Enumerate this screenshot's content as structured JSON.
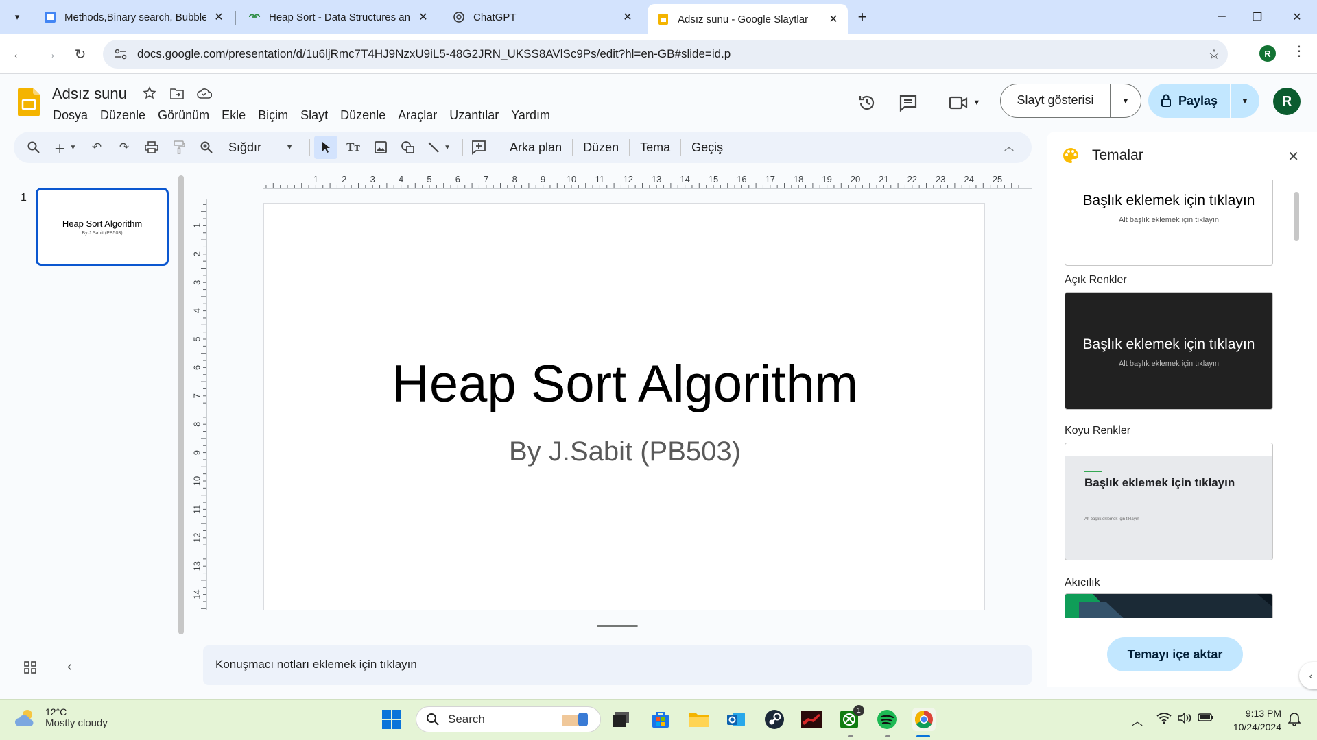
{
  "browser": {
    "tabs": [
      {
        "title": "Methods,Binary search, Bubble",
        "favicon": "slides-favicon",
        "active": false
      },
      {
        "title": "Heap Sort - Data Structures and",
        "favicon": "gfg-favicon",
        "active": false
      },
      {
        "title": "ChatGPT",
        "favicon": "chatgpt-favicon",
        "active": false
      },
      {
        "title": "Adsız sunu - Google Slaytlar",
        "favicon": "slides-favicon",
        "active": true
      }
    ],
    "url": "docs.google.com/presentation/d/1u6ljRmc7T4HJ9NzxU9iL5-48G2JRN_UKSS8AVlSc9Ps/edit?hl=en-GB#slide=id.p",
    "profile_initial": "R"
  },
  "app": {
    "doc_title": "Adsız sunu",
    "menu": [
      "Dosya",
      "Düzenle",
      "Görünüm",
      "Ekle",
      "Biçim",
      "Slayt",
      "Düzenle",
      "Araçlar",
      "Uzantılar",
      "Yardım"
    ],
    "slideshow_label": "Slayt gösterisi",
    "share_label": "Paylaş",
    "avatar_initial": "R"
  },
  "toolbar": {
    "zoom_label": "Sığdır",
    "text_buttons": [
      "Arka plan",
      "Düzen",
      "Tema",
      "Geçiş"
    ]
  },
  "rulers": {
    "horizontal": [
      "1",
      "2",
      "3",
      "4",
      "5",
      "6",
      "7",
      "8",
      "9",
      "10",
      "11",
      "12",
      "13",
      "14",
      "15",
      "16",
      "17",
      "18",
      "19",
      "20",
      "21",
      "22",
      "23",
      "24",
      "25"
    ],
    "vertical": [
      "1",
      "2",
      "3",
      "4",
      "5",
      "6",
      "7",
      "8",
      "9",
      "10",
      "11",
      "12",
      "13",
      "14"
    ]
  },
  "filmstrip": {
    "slide_number": "1",
    "thumb_title": "Heap Sort Algorithm",
    "thumb_subtitle": "By J.Sabit (PB503)"
  },
  "slide": {
    "title": "Heap Sort Algorithm",
    "subtitle": "By J.Sabit (PB503)"
  },
  "notes_placeholder": "Konuşmacı notları eklemek için tıklayın",
  "themes": {
    "title": "Temalar",
    "preview_title": "Başlık eklemek için tıklayın",
    "preview_subtitle": "Alt başlık eklemek için tıklayın",
    "items": [
      {
        "name": "Açık Renkler"
      },
      {
        "name": "Koyu Renkler"
      },
      {
        "name": "Akıcılık"
      }
    ],
    "import_label": "Temayı içe aktar"
  },
  "taskbar": {
    "temperature": "12°C",
    "condition": "Mostly cloudy",
    "search_label": "Search",
    "time": "9:13 PM",
    "date": "10/24/2024",
    "xbox_badge": "1"
  },
  "colors": {
    "accent": "#0b57d0",
    "share_bg": "#c2e7ff",
    "slides_yellow": "#f4b400",
    "tabbar_bg": "#d3e3fd"
  }
}
